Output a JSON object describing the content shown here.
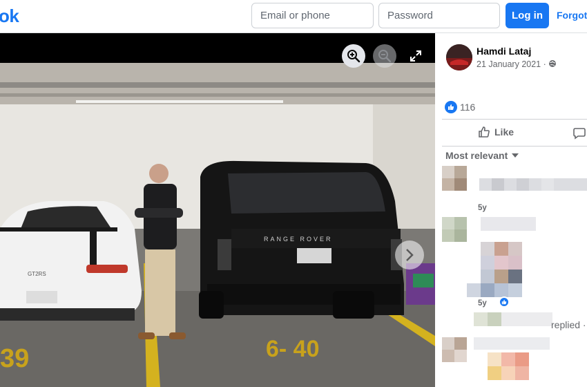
{
  "header": {
    "logo_text": "ok",
    "email_placeholder": "Email or phone",
    "password_placeholder": "Password",
    "login_label": "Log in",
    "forgot_label": "Forgot"
  },
  "viewer": {
    "photo_alt": "Photo",
    "car_badge_text": "RANGE ROVER",
    "porsche_badge_text": "GT2RS",
    "parking_spot_left": "39",
    "parking_spot_right": "6- 40"
  },
  "post": {
    "author": "Hamdi Lataj",
    "date": "21 January 2021 ·",
    "reaction_count": "116",
    "like_action_label": "Like"
  },
  "comments": {
    "sort_label": "Most relevant",
    "items": [
      {
        "time": "5y"
      },
      {
        "time": "5y"
      }
    ],
    "replied_text": "replied ·"
  },
  "colors": {
    "brand": "#1877f2",
    "secondary_text": "#65676b"
  }
}
